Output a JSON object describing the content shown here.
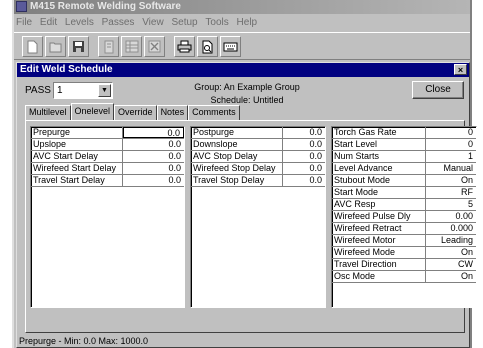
{
  "app": {
    "title": "M415 Remote Welding Software",
    "menu": [
      "File",
      "Edit",
      "Levels",
      "Passes",
      "View",
      "Setup",
      "Tools",
      "Help"
    ],
    "toolbar": [
      "new-icon",
      "open-icon",
      "save-icon",
      "document-icon",
      "grid-icon",
      "delete-icon",
      "print-icon",
      "print-preview-icon",
      "keyboard-icon"
    ]
  },
  "dialog": {
    "title": "Edit Weld Schedule",
    "close_x": "×",
    "pass_label": "PASS #:",
    "pass_value": "1",
    "group": "Group: An Example Group",
    "schedule": "Schedule: Untitled",
    "close_button": "Close",
    "tabs": [
      "Multilevel",
      "Onelevel",
      "Override",
      "Notes",
      "Comments"
    ],
    "active_tab": "Onelevel",
    "grid1": [
      {
        "label": "Prepurge",
        "value": "0.0"
      },
      {
        "label": "Upslope",
        "value": "0.0"
      },
      {
        "label": "AVC Start Delay",
        "value": "0.0"
      },
      {
        "label": "Wirefeed Start Delay",
        "value": "0.0"
      },
      {
        "label": "Travel Start Delay",
        "value": "0.0"
      }
    ],
    "grid2": [
      {
        "label": "Postpurge",
        "value": "0.0"
      },
      {
        "label": "Downslope",
        "value": "0.0"
      },
      {
        "label": "AVC Stop Delay",
        "value": "0.0"
      },
      {
        "label": "Wirefeed Stop Delay",
        "value": "0.0"
      },
      {
        "label": "Travel Stop Delay",
        "value": "0.0"
      }
    ],
    "grid3": [
      {
        "label": "Torch Gas Rate",
        "value": "0"
      },
      {
        "label": "Start Level",
        "value": "0"
      },
      {
        "label": "Num Starts",
        "value": "1"
      },
      {
        "label": "Level Advance",
        "value": "Manual"
      },
      {
        "label": "Stubout Mode",
        "value": "On"
      },
      {
        "label": "Start Mode",
        "value": "RF"
      },
      {
        "label": "AVC Resp",
        "value": "5"
      },
      {
        "label": "Wirefeed Pulse Dly",
        "value": "0.00"
      },
      {
        "label": "Wirefeed Retract",
        "value": "0.000"
      },
      {
        "label": "Wirefeed Motor",
        "value": "Leading"
      },
      {
        "label": "Wirefeed Mode",
        "value": "On"
      },
      {
        "label": "Travel Direction",
        "value": "CW"
      },
      {
        "label": "Osc Mode",
        "value": "On"
      }
    ],
    "status": "Prepurge - Min:  0.0   Max: 1000.0"
  }
}
